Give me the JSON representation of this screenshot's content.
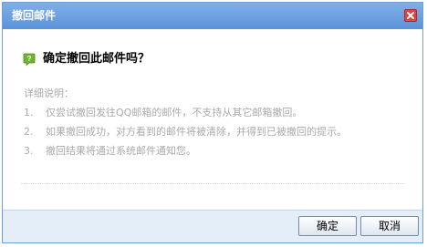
{
  "dialog": {
    "title": "撤回邮件",
    "close_icon": "close-icon",
    "question_icon": "question-icon",
    "question": "确定撤回此邮件吗？",
    "detail_title": "详细说明：",
    "details": [
      {
        "num": "1.",
        "text": "仅尝试撤回发往QQ邮箱的邮件，不支持从其它邮箱撤回。"
      },
      {
        "num": "2.",
        "text": "如果撤回成功，对方看到的邮件将被清除，并得到已被撤回的提示。"
      },
      {
        "num": "3.",
        "text": "撤回结果将通过系统邮件通知您。"
      }
    ],
    "ok_label": "确定",
    "cancel_label": "取消"
  },
  "colors": {
    "titlebar": "#5b93d8",
    "close": "#e2423a",
    "question_icon": "#6fb52c",
    "footer": "#e4eef8",
    "detail_text": "#aaaaaa"
  }
}
